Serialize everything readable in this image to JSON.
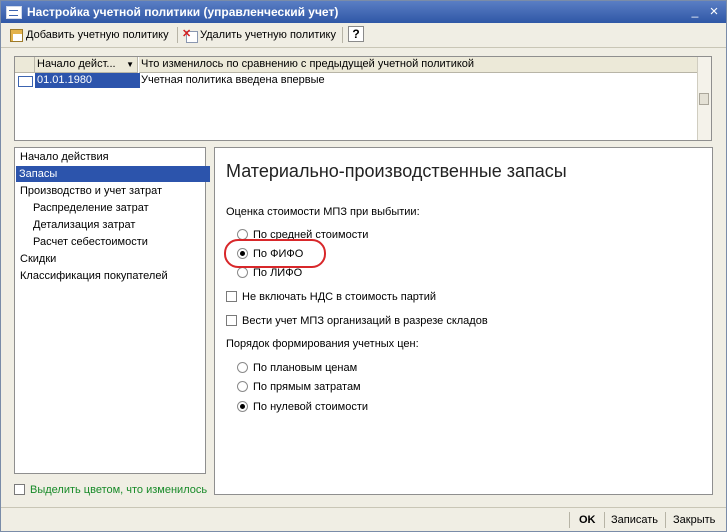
{
  "window": {
    "title": "Настройка учетной политики (управленческий учет)",
    "minimize": "_",
    "close": "×"
  },
  "toolbar": {
    "add_label": "Добавить учетную политику",
    "delete_label": "Удалить учетную политику",
    "help_label": "?"
  },
  "table": {
    "columns": [
      "Начало дейст...",
      "Что изменилось по сравнению с предыдущей учетной политикой"
    ],
    "sort_icon": "▼",
    "rows": [
      {
        "date": "01.01.1980",
        "change": "Учетная политика введена впервые"
      }
    ]
  },
  "nav": {
    "items": [
      {
        "label": "Начало действия"
      },
      {
        "label": "Запасы"
      },
      {
        "label": "Производство и учет затрат"
      },
      {
        "label": "Распределение затрат"
      },
      {
        "label": "Детализация затрат"
      },
      {
        "label": "Расчет себестоимости"
      },
      {
        "label": "Скидки"
      },
      {
        "label": "Классификация покупателей"
      }
    ]
  },
  "main": {
    "title": "Материально-производственные запасы",
    "valuation_label": "Оценка стоимости МПЗ при выбытии:",
    "valuation_options": [
      "По средней стоимости",
      "По ФИФО",
      "По ЛИФО"
    ],
    "valuation_selected": "По ФИФО",
    "checkbox_vat": "Не включать НДС в стоимость партий",
    "checkbox_warehouses": "Вести учет МПЗ организаций в разрезе складов",
    "price_label": "Порядок формирования учетных цен:",
    "price_options": [
      "По плановым ценам",
      "По прямым затратам",
      "По нулевой стоимости"
    ],
    "price_selected": "По нулевой стоимости"
  },
  "highlight_checkbox": "Выделить цветом, что изменилось",
  "footer": {
    "ok": "OK",
    "save": "Записать",
    "close": "Закрыть"
  },
  "colors": {
    "title_bar": "#2f57a6",
    "selection": "#2c54ac",
    "highlight_ring": "#d8272a",
    "green_text": "#178a28"
  },
  "icons": [
    "policy-window-icon",
    "add-policy-icon",
    "delete-policy-icon",
    "help-icon",
    "policy-row-icon"
  ]
}
